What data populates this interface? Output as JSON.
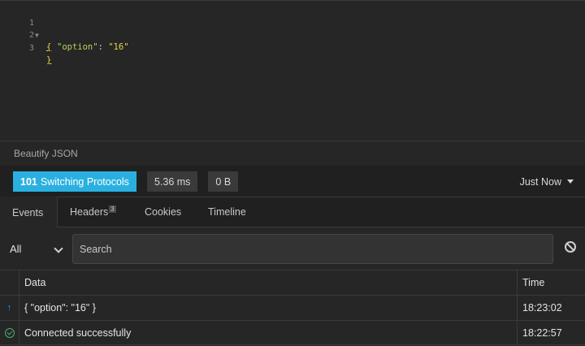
{
  "editor": {
    "lines": [
      {
        "num": "1",
        "open_brace": "{"
      },
      {
        "num": "2",
        "key": "\"option\"",
        "colon": ": ",
        "value": "\"16\""
      },
      {
        "num": "3",
        "close_brace": "}"
      }
    ]
  },
  "beautify_label": "Beautify JSON",
  "status": {
    "code": "101",
    "text": "Switching Protocols",
    "time": "5.36 ms",
    "size": "0 B",
    "history": "Just Now"
  },
  "tabs": [
    {
      "label": "Events"
    },
    {
      "label": "Headers",
      "count": "3"
    },
    {
      "label": "Cookies"
    },
    {
      "label": "Timeline"
    }
  ],
  "filter": {
    "selected": "All",
    "search_placeholder": "Search"
  },
  "table": {
    "headers": {
      "data": "Data",
      "time": "Time"
    },
    "rows": [
      {
        "icon": "arrow-up-icon",
        "data": "{ \"option\": \"16\" }",
        "time": "18:23:02"
      },
      {
        "icon": "check-circle-icon",
        "data": "Connected successfully",
        "time": "18:22:57"
      }
    ]
  },
  "colors": {
    "status_badge": "#2ab0e0",
    "sent_arrow": "#3b8eea",
    "success": "#4caf6a",
    "json_string": "#e8d44d",
    "json_key": "#b8d35a"
  }
}
